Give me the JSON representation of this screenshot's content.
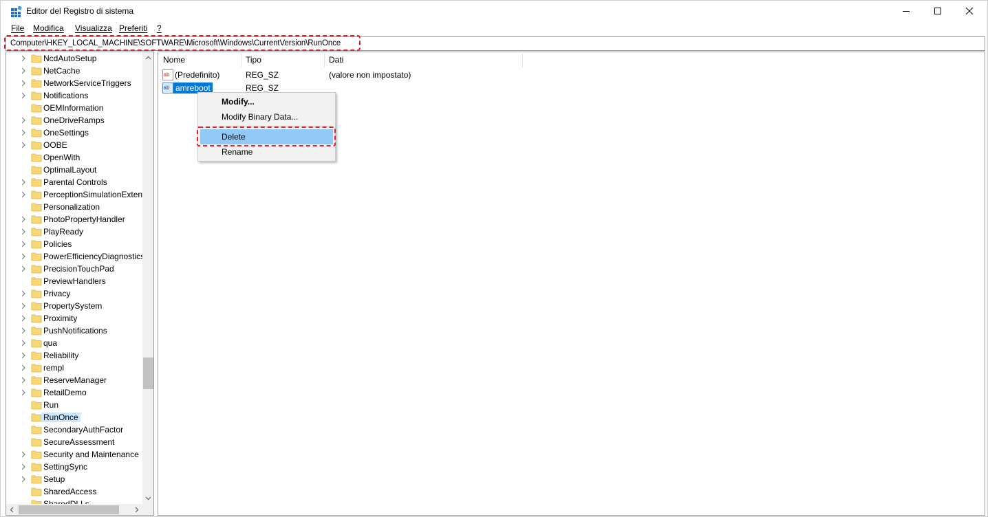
{
  "window": {
    "title": "Editor del Registro di sistema"
  },
  "menu": [
    "File",
    "Modifica",
    "Visualizza",
    "Preferiti",
    "?"
  ],
  "address": {
    "path": "Computer\\HKEY_LOCAL_MACHINE\\SOFTWARE\\Microsoft\\Windows\\CurrentVersion\\RunOnce"
  },
  "tree": {
    "selected": "RunOnce",
    "items": [
      {
        "label": "NcdAutoSetup",
        "expandable": true
      },
      {
        "label": "NetCache",
        "expandable": true
      },
      {
        "label": "NetworkServiceTriggers",
        "expandable": true
      },
      {
        "label": "Notifications",
        "expandable": true
      },
      {
        "label": "OEMInformation",
        "expandable": false
      },
      {
        "label": "OneDriveRamps",
        "expandable": true
      },
      {
        "label": "OneSettings",
        "expandable": true
      },
      {
        "label": "OOBE",
        "expandable": true
      },
      {
        "label": "OpenWith",
        "expandable": false
      },
      {
        "label": "OptimalLayout",
        "expandable": false
      },
      {
        "label": "Parental Controls",
        "expandable": true
      },
      {
        "label": "PerceptionSimulationExten",
        "expandable": true
      },
      {
        "label": "Personalization",
        "expandable": false
      },
      {
        "label": "PhotoPropertyHandler",
        "expandable": true
      },
      {
        "label": "PlayReady",
        "expandable": true
      },
      {
        "label": "Policies",
        "expandable": true
      },
      {
        "label": "PowerEfficiencyDiagnostics",
        "expandable": true
      },
      {
        "label": "PrecisionTouchPad",
        "expandable": true
      },
      {
        "label": "PreviewHandlers",
        "expandable": false
      },
      {
        "label": "Privacy",
        "expandable": true
      },
      {
        "label": "PropertySystem",
        "expandable": true
      },
      {
        "label": "Proximity",
        "expandable": true
      },
      {
        "label": "PushNotifications",
        "expandable": true
      },
      {
        "label": "qua",
        "expandable": true
      },
      {
        "label": "Reliability",
        "expandable": true
      },
      {
        "label": "rempl",
        "expandable": true
      },
      {
        "label": "ReserveManager",
        "expandable": true
      },
      {
        "label": "RetailDemo",
        "expandable": true
      },
      {
        "label": "Run",
        "expandable": false
      },
      {
        "label": "RunOnce",
        "expandable": false
      },
      {
        "label": "SecondaryAuthFactor",
        "expandable": false
      },
      {
        "label": "SecureAssessment",
        "expandable": false
      },
      {
        "label": "Security and Maintenance",
        "expandable": true
      },
      {
        "label": "SettingSync",
        "expandable": true
      },
      {
        "label": "Setup",
        "expandable": true
      },
      {
        "label": "SharedAccess",
        "expandable": false
      },
      {
        "label": "SharedDLLs",
        "expandable": false
      }
    ]
  },
  "values": {
    "columns": [
      "Nome",
      "Tipo",
      "Dati"
    ],
    "rows": [
      {
        "name": "(Predefinito)",
        "type": "REG_SZ",
        "data": "(valore non impostato)",
        "icon": "string-value-icon"
      },
      {
        "name": "amreboot",
        "type": "REG_SZ",
        "data": "",
        "icon": "string-value-icon",
        "selected": true
      }
    ]
  },
  "context_menu": {
    "items": [
      "Modify...",
      "Modify Binary Data...",
      "Delete",
      "Rename"
    ],
    "highlighted": "Delete"
  },
  "colors": {
    "selection": "#0078d7",
    "tree_selection": "#cce8ff",
    "menu_hover": "#91c9f7",
    "annotation": "#e0212b",
    "folder": "#f8d775"
  }
}
